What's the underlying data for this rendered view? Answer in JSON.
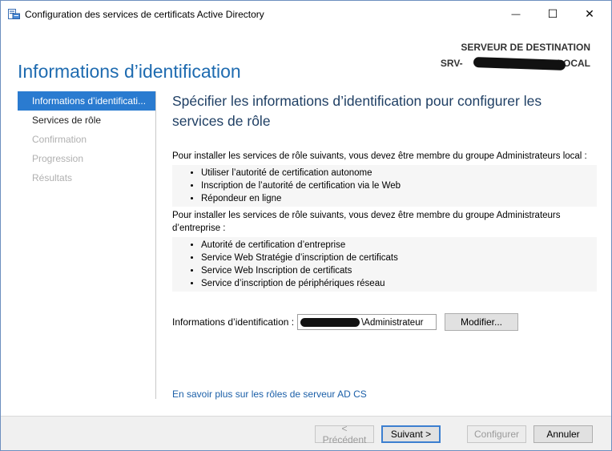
{
  "window": {
    "title": "Configuration des services de certificats Active Directory",
    "controls": {
      "minimize": "—",
      "maximize": "☐",
      "close": "✕"
    },
    "icon": "server-manager-icon"
  },
  "header": {
    "page_title": "Informations d’identification",
    "destination_label": "SERVEUR DE DESTINATION",
    "destination_value": "SRV-",
    "destination_suffix": "LOCAL"
  },
  "sidebar": {
    "items": [
      {
        "label": "Informations d’identificati...",
        "state": "active"
      },
      {
        "label": "Services de rôle",
        "state": "normal"
      },
      {
        "label": "Confirmation",
        "state": "disabled"
      },
      {
        "label": "Progression",
        "state": "disabled"
      },
      {
        "label": "Résultats",
        "state": "disabled"
      }
    ]
  },
  "main": {
    "heading": "Spécifier les informations d’identification pour configurer les services de rôle",
    "local_intro": "Pour installer les services de rôle suivants, vous devez être membre du groupe Administrateurs local :",
    "local_items": [
      "Utiliser l’autorité de certification autonome",
      "Inscription de l’autorité de certification via le Web",
      "Répondeur en ligne"
    ],
    "enterprise_intro": "Pour installer les services de rôle suivants, vous devez être membre du groupe Administrateurs d’entreprise :",
    "enterprise_items": [
      "Autorité de certification d’entreprise",
      "Service Web Stratégie d’inscription de certificats",
      "Service Web Inscription de certificats",
      "Service d’inscription de périphériques réseau"
    ],
    "credentials_label": "Informations d’identification :",
    "credentials_value": "\\Administrateur",
    "modify_button": "Modifier...",
    "learn_more_link": "En savoir plus sur les rôles de serveur AD CS"
  },
  "footer": {
    "previous_button": "< Précédent",
    "next_button": "Suivant >",
    "configure_button": "Configurer",
    "cancel_button": "Annuler"
  },
  "colors": {
    "accent": "#2a7bd0",
    "heading": "#1e6bb0",
    "link": "#1b5fa8"
  }
}
